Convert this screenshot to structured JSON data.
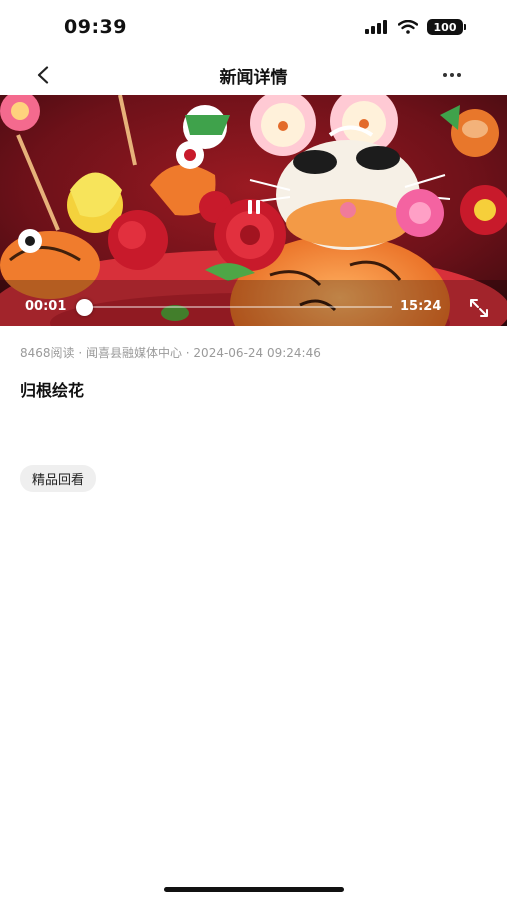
{
  "status_bar": {
    "time": "09:39",
    "battery": "100",
    "icons": [
      "signal-icon",
      "wifi-icon",
      "battery-icon"
    ]
  },
  "nav": {
    "title": "新闻详情",
    "back_icon": "chevron-left-icon",
    "more_icon": "more-dots-icon"
  },
  "video": {
    "current_time": "00:01",
    "duration": "15:24",
    "progress_fraction": 0.001,
    "state_icon": "pause-icon",
    "fullscreen_icon": "fullscreen-icon"
  },
  "article": {
    "meta": "8468阅读 · 闻喜县融媒体中心 · 2024-06-24 09:24:46",
    "title": "归根绘花",
    "tag": "精品回看"
  },
  "colors": {
    "meta_text": "#9a9a9a",
    "chip_bg": "#efefef",
    "video_bg": "#5a0f16"
  }
}
